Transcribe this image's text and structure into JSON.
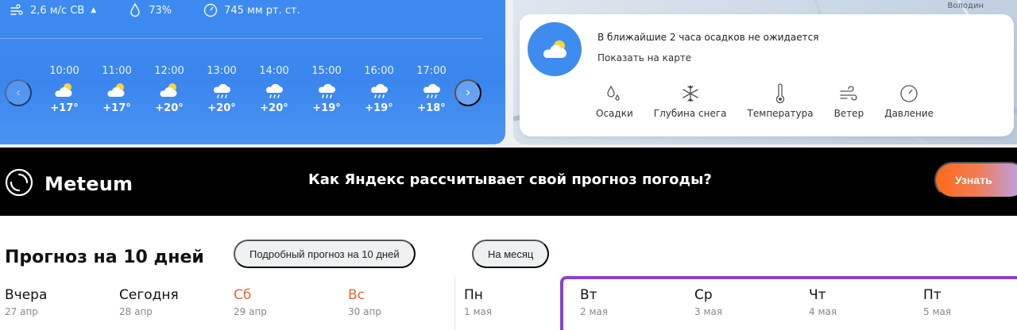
{
  "hourly": {
    "metrics": {
      "wind": "2,6 м/с СВ",
      "humidity": "73%",
      "pressure": "745 мм рт. ст."
    },
    "hours": [
      {
        "time": "10:00",
        "temp": "+17°",
        "icon": "partly-cloudy-icon"
      },
      {
        "time": "11:00",
        "temp": "+17°",
        "icon": "partly-cloudy-icon"
      },
      {
        "time": "12:00",
        "temp": "+20°",
        "icon": "partly-cloudy-icon"
      },
      {
        "time": "13:00",
        "temp": "+20°",
        "icon": "rain-cloud-icon"
      },
      {
        "time": "14:00",
        "temp": "+20°",
        "icon": "rain-cloud-icon"
      },
      {
        "time": "15:00",
        "temp": "+19°",
        "icon": "rain-cloud-icon"
      },
      {
        "time": "16:00",
        "temp": "+19°",
        "icon": "rain-cloud-icon"
      },
      {
        "time": "17:00",
        "temp": "+18°",
        "icon": "rain-cloud-icon"
      }
    ]
  },
  "map": {
    "corner_label": "Володин",
    "precip_text": "В ближайшие 2 часа осадков не ожидается",
    "show_on_map": "Показать на карте",
    "layers": [
      {
        "label": "Осадки",
        "icon": "precipitation-icon"
      },
      {
        "label": "Глубина снега",
        "icon": "snowflake-icon"
      },
      {
        "label": "Температура",
        "icon": "thermometer-icon"
      },
      {
        "label": "Ветер",
        "icon": "wind-icon"
      },
      {
        "label": "Давление",
        "icon": "pressure-icon"
      }
    ]
  },
  "banner": {
    "logo": "Meteum",
    "question": "Как Яндекс рассчитывает свой прогноз погоды?",
    "cta": "Узнать"
  },
  "forecast": {
    "title": "Прогноз на 10 дней",
    "chip_detailed": "Подробный прогноз на 10 дней",
    "chip_month": "На месяц",
    "days": [
      {
        "name": "Вчера",
        "date": "27 апр",
        "weekend": false
      },
      {
        "name": "Сегодня",
        "date": "28 апр",
        "weekend": false
      },
      {
        "name": "Сб",
        "date": "29 апр",
        "weekend": true
      },
      {
        "name": "Вс",
        "date": "30 апр",
        "weekend": true
      },
      {
        "name": "Пн",
        "date": "1 мая",
        "weekend": false
      },
      {
        "name": "Вт",
        "date": "2 мая",
        "weekend": false
      },
      {
        "name": "Ср",
        "date": "3 мая",
        "weekend": false
      },
      {
        "name": "Чт",
        "date": "4 мая",
        "weekend": false
      },
      {
        "name": "Пт",
        "date": "5 мая",
        "weekend": false
      }
    ]
  }
}
